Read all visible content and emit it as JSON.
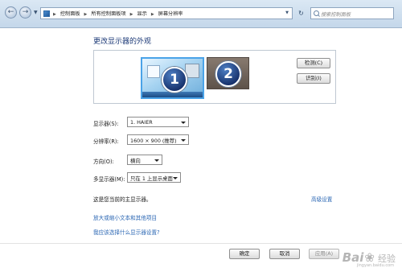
{
  "address_bar": {
    "breadcrumbs": [
      "控制面板",
      "所有控制面板项",
      "显示",
      "屏幕分辨率"
    ],
    "search_placeholder": "搜索控制面板",
    "back_icon": "back-arrow-icon",
    "forward_icon": "forward-arrow-icon",
    "refresh_icon": "refresh-icon"
  },
  "page": {
    "title": "更改显示器的外观",
    "monitors": [
      {
        "number": "1",
        "selected": true
      },
      {
        "number": "2",
        "selected": false
      }
    ],
    "detect_button": "检测(C)",
    "identify_button": "识别(I)",
    "fields": {
      "display": {
        "label": "显示器(S):",
        "value": "1. HAIER"
      },
      "resolution": {
        "label": "分辨率(R):",
        "value": "1600 × 900 (推荐)"
      },
      "orientation": {
        "label": "方向(O):",
        "value": "横向"
      },
      "multi_display": {
        "label": "多显示器(M):",
        "value": "只在 1 上显示桌面"
      }
    },
    "info_text": "这是您当前的主显示器。",
    "advanced_link": "高级设置",
    "text_size_link": "放大或缩小文本和其他项目",
    "help_link": "我应该选择什么显示器设置?"
  },
  "footer": {
    "ok": "确定",
    "cancel": "取消",
    "apply": "应用(A)"
  },
  "watermark": {
    "brand_left": "Bai",
    "brand_right": "经验",
    "site": "jingyan.baidu.com"
  },
  "colors": {
    "title": "#1e3b78",
    "link": "#2a66b3",
    "selected_border": "#4aa3e8"
  }
}
